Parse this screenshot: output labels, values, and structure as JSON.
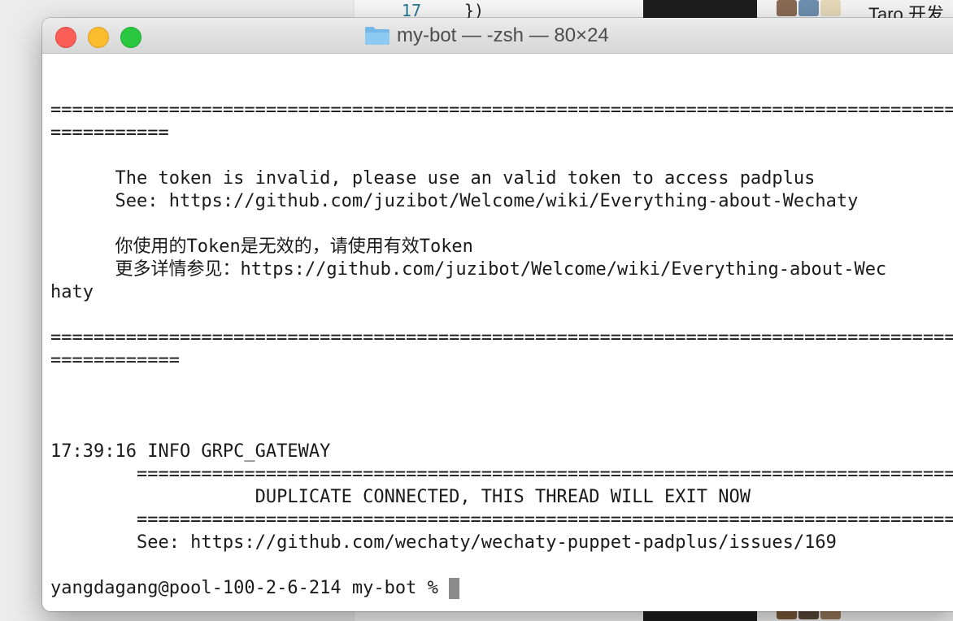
{
  "background": {
    "editor": {
      "line_number": "17",
      "code": "})"
    },
    "right_panel": {
      "text": "Taro 开发"
    }
  },
  "terminal": {
    "title": "my-bot — -zsh — 80×24",
    "lines": [
      "",
      "",
      "====================================================================================================",
      "===========",
      "",
      "      The token is invalid, please use an valid token to access padplus",
      "      See: https://github.com/juzibot/Welcome/wiki/Everything-about-Wechaty",
      "",
      "      你使用的Token是无效的，请使用有效Token",
      "      更多详情参见：https://github.com/juzibot/Welcome/wiki/Everything-about-Wec",
      "haty",
      "",
      "====================================================================================================",
      "============",
      "",
      "",
      "",
      "17:39:16 INFO GRPC_GATEWAY",
      "        =============================================================================",
      "                   DUPLICATE CONNECTED, THIS THREAD WILL EXIT NOW",
      "        =============================================================================",
      "        See: https://github.com/wechaty/wechaty-puppet-padplus/issues/169",
      ""
    ],
    "prompt": "yangdagang@pool-100-2-6-214 my-bot %"
  }
}
